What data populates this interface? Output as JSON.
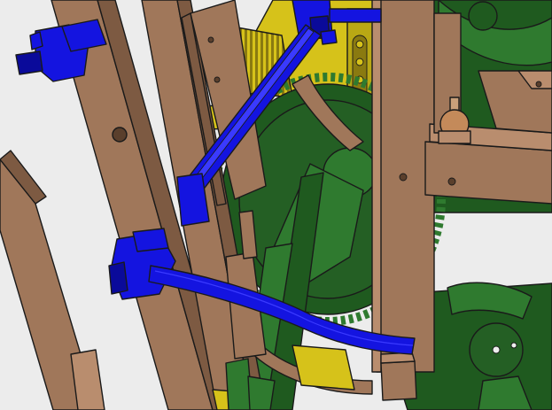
{
  "scene": {
    "colors": {
      "background": "#ececec",
      "wood": "#a0775a",
      "wood_dark": "#7d5a42",
      "wood_light": "#b98d6e",
      "gear_green": "#1f5a1f",
      "gear_green_dark": "#134013",
      "gear_green_light": "#2f7a2f",
      "lever_blue": "#1414e0",
      "lever_blue_dark": "#0a0a9a",
      "brass_yellow": "#d6c21a",
      "brass_dark": "#9a8a10",
      "outline": "#1a1a1a"
    },
    "parts": [
      "wooden-frame-post",
      "blue-lever-arm",
      "green-gear-wheel",
      "yellow-rack-mechanism",
      "wooden-knob"
    ]
  }
}
